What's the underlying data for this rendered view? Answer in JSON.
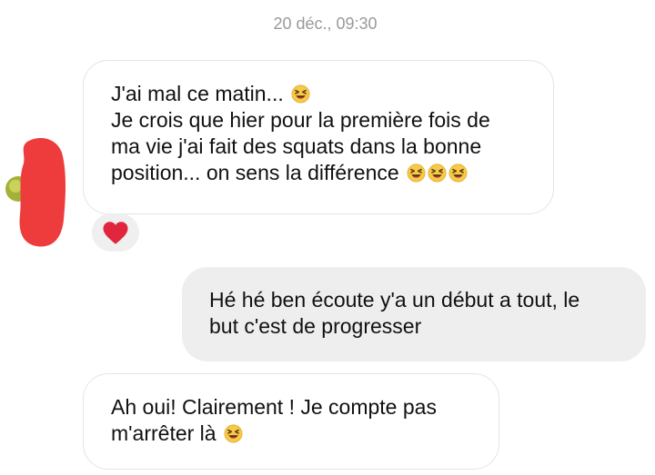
{
  "timestamp": "20 déc., 09:30",
  "messages": [
    {
      "direction": "incoming",
      "lines": [
        {
          "text": "J'ai mal ce matin...",
          "emoji": "laughing-squint-emoji",
          "emoji_count": 1
        },
        {
          "text": "Je crois que hier pour la première fois de"
        },
        {
          "text": "ma vie j'ai fait des squats dans la bonne"
        },
        {
          "text": "position...  on sens la différence",
          "emoji": "laughing-squint-emoji",
          "emoji_count": 3
        }
      ],
      "reaction": {
        "icon": "heart-icon",
        "color": "#e0253c"
      }
    },
    {
      "direction": "outgoing",
      "lines": [
        {
          "text": "Hé hé ben écoute y'a un début a tout, le"
        },
        {
          "text": "but c'est de progresser"
        }
      ]
    },
    {
      "direction": "incoming",
      "lines": [
        {
          "text": "Ah oui! Clairement ! Je compte pas"
        },
        {
          "text": "m'arrêter là",
          "emoji": "laughing-squint-emoji",
          "emoji_count": 1
        }
      ]
    }
  ],
  "colors": {
    "incoming_bubble": "#ffffff",
    "outgoing_bubble": "#eeeeee",
    "timestamp_text": "#9a9a9a",
    "redaction": "#ee3b3b",
    "emoji_face": "#f7c948"
  }
}
